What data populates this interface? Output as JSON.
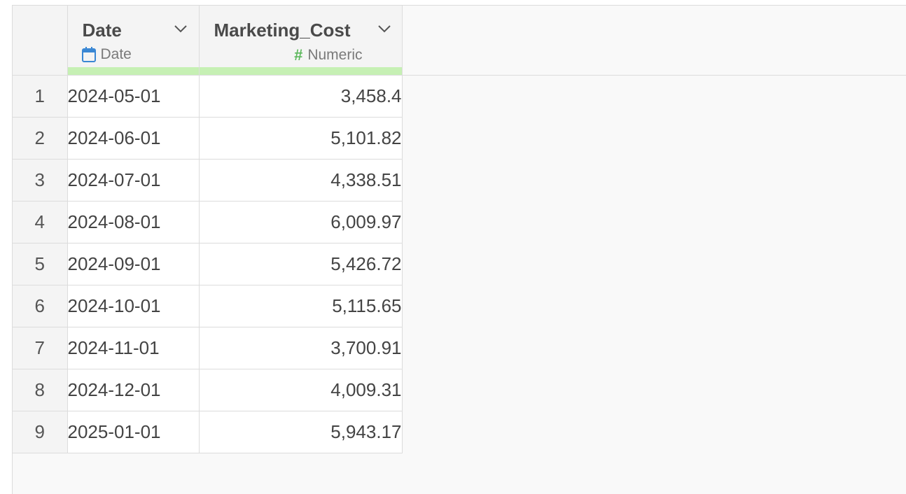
{
  "columns": [
    {
      "name": "Date",
      "type_label": "Date",
      "type_icon": "calendar-icon"
    },
    {
      "name": "Marketing_Cost",
      "type_label": "Numeric",
      "type_icon": "hash-icon"
    }
  ],
  "rows": [
    {
      "num": "1",
      "date": "2024-05-01",
      "cost": "3,458.4"
    },
    {
      "num": "2",
      "date": "2024-06-01",
      "cost": "5,101.82"
    },
    {
      "num": "3",
      "date": "2024-07-01",
      "cost": "4,338.51"
    },
    {
      "num": "4",
      "date": "2024-08-01",
      "cost": "6,009.97"
    },
    {
      "num": "5",
      "date": "2024-09-01",
      "cost": "5,426.72"
    },
    {
      "num": "6",
      "date": "2024-10-01",
      "cost": "5,115.65"
    },
    {
      "num": "7",
      "date": "2024-11-01",
      "cost": "3,700.91"
    },
    {
      "num": "8",
      "date": "2024-12-01",
      "cost": "4,009.31"
    },
    {
      "num": "9",
      "date": "2025-01-01",
      "cost": "5,943.17"
    }
  ],
  "colors": {
    "quality_bar": "#c6f0b4",
    "date_icon": "#3a87d4",
    "numeric_icon": "#5cb85c"
  }
}
